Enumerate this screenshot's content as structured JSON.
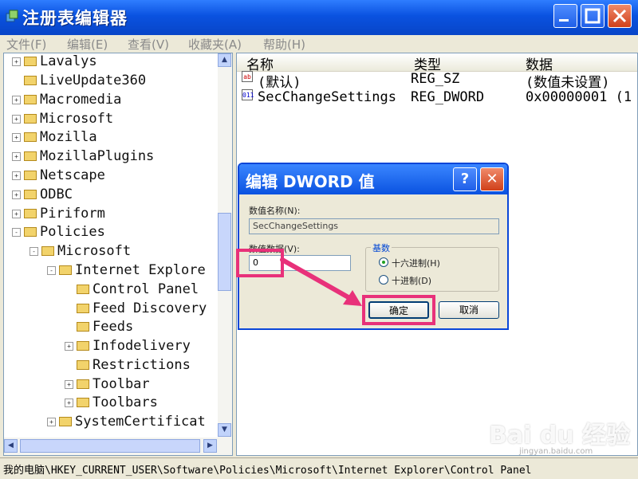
{
  "window": {
    "title": "注册表编辑器"
  },
  "menu": [
    "文件(F)",
    "编辑(E)",
    "查看(V)",
    "收藏夹(A)",
    "帮助(H)"
  ],
  "tree": {
    "items": [
      {
        "label": "Lavalys",
        "expander": "+"
      },
      {
        "label": "LiveUpdate360",
        "expander": ""
      },
      {
        "label": "Macromedia",
        "expander": "+"
      },
      {
        "label": "Microsoft",
        "expander": "+"
      },
      {
        "label": "Mozilla",
        "expander": "+"
      },
      {
        "label": "MozillaPlugins",
        "expander": "+"
      },
      {
        "label": "Netscape",
        "expander": "+"
      },
      {
        "label": "ODBC",
        "expander": "+"
      },
      {
        "label": "Piriform",
        "expander": "+"
      },
      {
        "label": "Policies",
        "expander": "-"
      },
      {
        "label": "Microsoft",
        "expander": "-"
      },
      {
        "label": "Internet Explore",
        "expander": "-"
      },
      {
        "label": "Control Panel",
        "expander": ""
      },
      {
        "label": "Feed Discovery",
        "expander": ""
      },
      {
        "label": "Feeds",
        "expander": ""
      },
      {
        "label": "Infodelivery",
        "expander": "+"
      },
      {
        "label": "Restrictions",
        "expander": ""
      },
      {
        "label": "Toolbar",
        "expander": "+"
      },
      {
        "label": "Toolbars",
        "expander": "+"
      },
      {
        "label": "SystemCertificat",
        "expander": "+"
      }
    ]
  },
  "list": {
    "headers": [
      "名称",
      "类型",
      "数据"
    ],
    "rows": [
      {
        "icon": "ab",
        "name": "(默认)",
        "type": "REG_SZ",
        "data": "(数值未设置)"
      },
      {
        "icon": "011",
        "name": "SecChangeSettings",
        "type": "REG_DWORD",
        "data": "0x00000001 (1"
      }
    ]
  },
  "dialog": {
    "title": "编辑 DWORD 值",
    "help_label": "?",
    "close_label": "✕",
    "value_name_label": "数值名称(N):",
    "value_name": "SecChangeSettings",
    "value_data_label": "数值数据(V):",
    "value_data": "0",
    "base_label": "基数",
    "hex_label": "十六进制(H)",
    "dec_label": "十进制(D)",
    "ok_label": "确定",
    "cancel_label": "取消"
  },
  "status_path": "我的电脑\\HKEY_CURRENT_USER\\Software\\Policies\\Microsoft\\Internet Explorer\\Control Panel",
  "watermark": {
    "brand": "Bai du 经验",
    "url": "jingyan.baidu.com"
  },
  "colors": {
    "titlebar": "#0a52e0",
    "highlight": "#e8317a"
  }
}
